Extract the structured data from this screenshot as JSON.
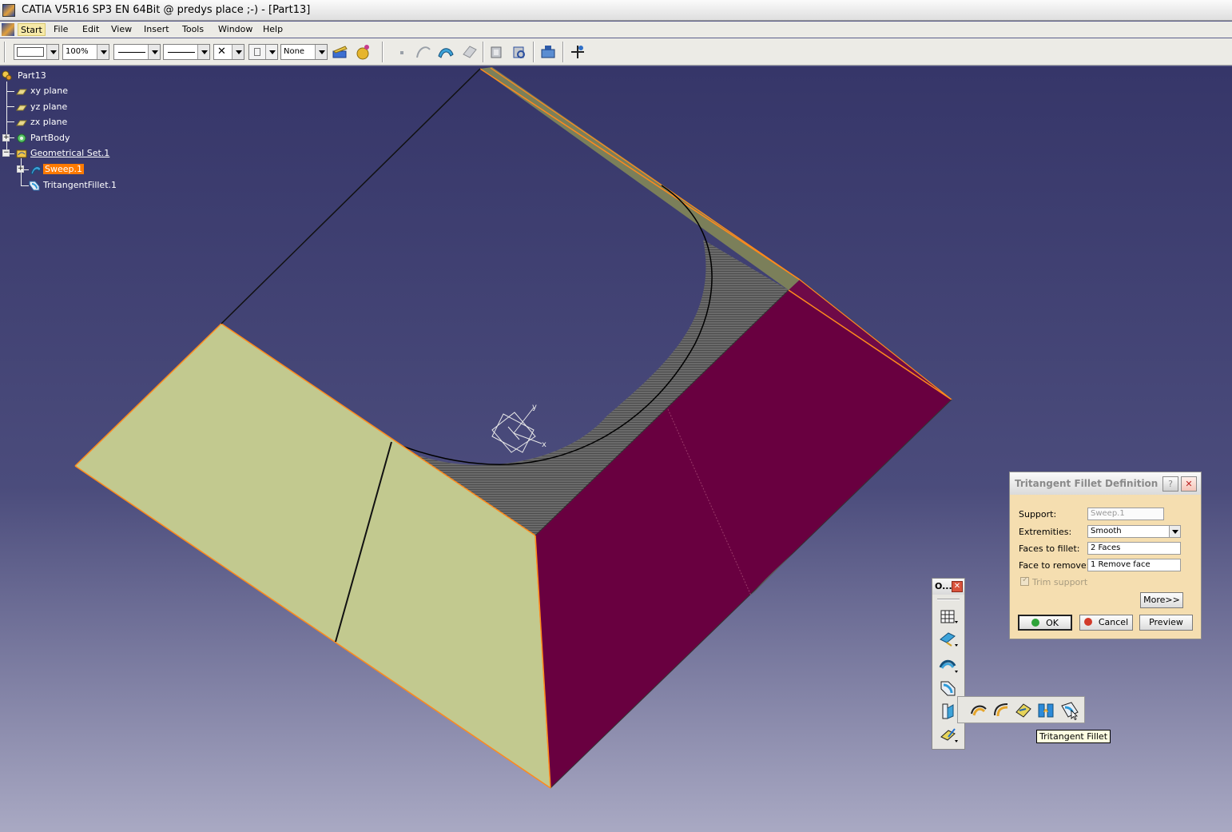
{
  "window": {
    "title": "CATIA V5R16 SP3 EN 64Bit @ predys place ;-) - [Part13]"
  },
  "menu": {
    "items": [
      {
        "label": "Start"
      },
      {
        "label": "File"
      },
      {
        "label": "Edit"
      },
      {
        "label": "View"
      },
      {
        "label": "Insert"
      },
      {
        "label": "Tools"
      },
      {
        "label": "Window"
      },
      {
        "label": "Help"
      }
    ]
  },
  "toolbar": {
    "zoom_value": "100%",
    "layer_value": "None",
    "icons": [
      "painter-icon",
      "material-icon",
      "point-icon",
      "curve-icon",
      "surface-icon",
      "solid-icon",
      "part-design-icon",
      "sketch-analysis-icon",
      "product-structure-icon",
      "compass-icon"
    ]
  },
  "tree": {
    "items": [
      {
        "label": "Part13",
        "icon": "part-icon"
      },
      {
        "label": "xy plane",
        "icon": "plane-icon"
      },
      {
        "label": "yz plane",
        "icon": "plane-icon"
      },
      {
        "label": "zx plane",
        "icon": "plane-icon"
      },
      {
        "label": "PartBody",
        "icon": "body-icon"
      },
      {
        "label": "Geometrical Set.1",
        "icon": "geometrical-set-icon"
      },
      {
        "label": "Sweep.1",
        "icon": "sweep-icon"
      },
      {
        "label": "TritangentFillet.1",
        "icon": "fillet-icon"
      }
    ]
  },
  "compass": {
    "axis_y": "y",
    "axis_x": "x"
  },
  "fillet_dialog": {
    "title": "Tritangent Fillet Definition",
    "help_label": "?",
    "support_label": "Support:",
    "support_value": "Sweep.1",
    "extremities_label": "Extremities:",
    "extremities_value": "Smooth",
    "faces_to_fillet_label": "Faces to fillet:",
    "faces_to_fillet_value": "2 Faces",
    "face_to_remove_label": "Face to remove:",
    "face_to_remove_value": "1 Remove face",
    "trim_support_label": "Trim support",
    "more_label": "More>>",
    "ok_label": "OK",
    "cancel_label": "Cancel",
    "preview_label": "Preview"
  },
  "ops_toolbar": {
    "title": "O...",
    "icons": [
      "join-icon",
      "extract-icon",
      "shape-fillet-icon",
      "edge-fillet-icon",
      "variable-fillet-icon",
      "translate-icon"
    ]
  },
  "fillet_flyout": {
    "icons": [
      "shape-fillet-icon",
      "edge-fillet-icon",
      "variable-fillet-icon",
      "face-face-fillet-icon",
      "tritangent-fillet-icon"
    ]
  },
  "tooltip": {
    "text": "Tritangent Fillet"
  },
  "colors": {
    "viewport_top": "#363669",
    "viewport_bottom": "#a9a9c3",
    "face_left": "#c2c98f",
    "face_right": "#690040",
    "highlight": "#ff8a1c",
    "selection": "#ff7a00"
  }
}
